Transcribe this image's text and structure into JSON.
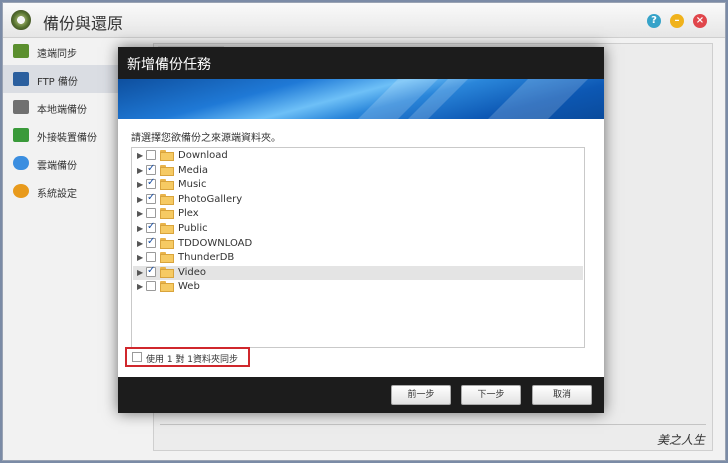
{
  "app": {
    "title": "備份與還原"
  },
  "window_buttons": {
    "help": "?",
    "minimize": "–",
    "close": "×"
  },
  "sidebar": {
    "items": [
      {
        "label": "遠端同步",
        "icon": "sync-icon",
        "color": "#5b8f2e"
      },
      {
        "label": "FTP 備份",
        "icon": "ftp-icon",
        "color": "#2b5f9e",
        "active": true
      },
      {
        "label": "本地端備份",
        "icon": "harddisk-icon",
        "color": "#707070"
      },
      {
        "label": "外接裝置備份",
        "icon": "usb-device-icon",
        "color": "#3a9a3a"
      },
      {
        "label": "雲端備份",
        "icon": "cloud-icon",
        "color": "#3b8ee0"
      },
      {
        "label": "系統設定",
        "icon": "gear-icon",
        "color": "#e89a1c"
      }
    ]
  },
  "dialog": {
    "title": "新增備份任務",
    "prompt": "請選擇您欲備份之來源端資料夾。",
    "folders": [
      {
        "name": "Download",
        "checked": false
      },
      {
        "name": "Media",
        "checked": true
      },
      {
        "name": "Music",
        "checked": true
      },
      {
        "name": "PhotoGallery",
        "checked": true
      },
      {
        "name": "Plex",
        "checked": false
      },
      {
        "name": "Public",
        "checked": true
      },
      {
        "name": "TDDOWNLOAD",
        "checked": true
      },
      {
        "name": "ThunderDB",
        "checked": false
      },
      {
        "name": "Video",
        "checked": true,
        "selected": true
      },
      {
        "name": "Web",
        "checked": false
      }
    ],
    "sync_option": {
      "label": "使用 1 對 1資料夾同步",
      "checked": false
    },
    "buttons": {
      "prev": "前一步",
      "next": "下一步",
      "cancel": "取消"
    }
  },
  "watermark": "美之人生",
  "colors": {
    "accent_red": "#d0272c",
    "dialog_header": "#1c1c1c",
    "banner_blue": "#1f79d6"
  }
}
